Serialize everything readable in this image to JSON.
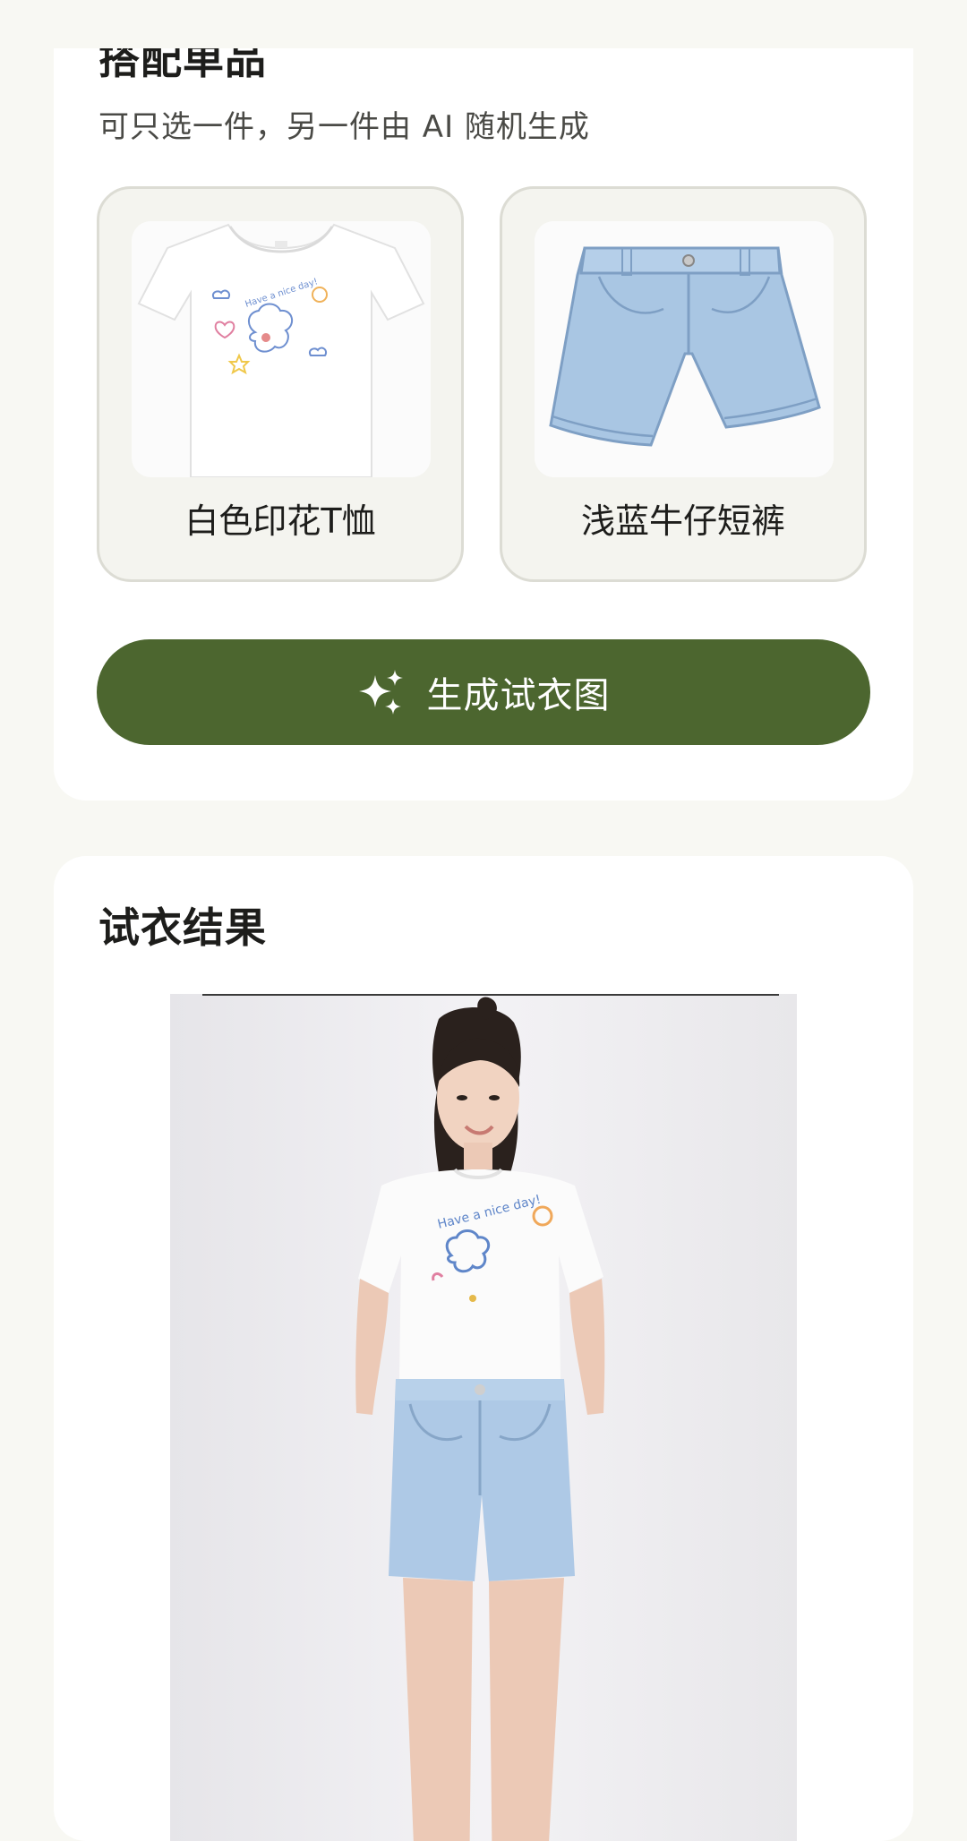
{
  "outfit": {
    "title": "搭配单品",
    "subtitle": "可只选一件，另一件由 AI 随机生成",
    "items": [
      {
        "label": "白色印花T恤",
        "icon": "tshirt-image"
      },
      {
        "label": "浅蓝牛仔短裤",
        "icon": "denim-shorts-image"
      }
    ],
    "generate_label": "生成试衣图",
    "generate_icon": "sparkle-icon"
  },
  "result": {
    "title": "试衣结果",
    "image": "tryon-result-photo"
  },
  "colors": {
    "page_bg": "#f8f8f3",
    "card_bg": "#ffffff",
    "item_bg": "#f4f4ef",
    "accent": "#4c662f",
    "denim": "#a9c6e3"
  }
}
